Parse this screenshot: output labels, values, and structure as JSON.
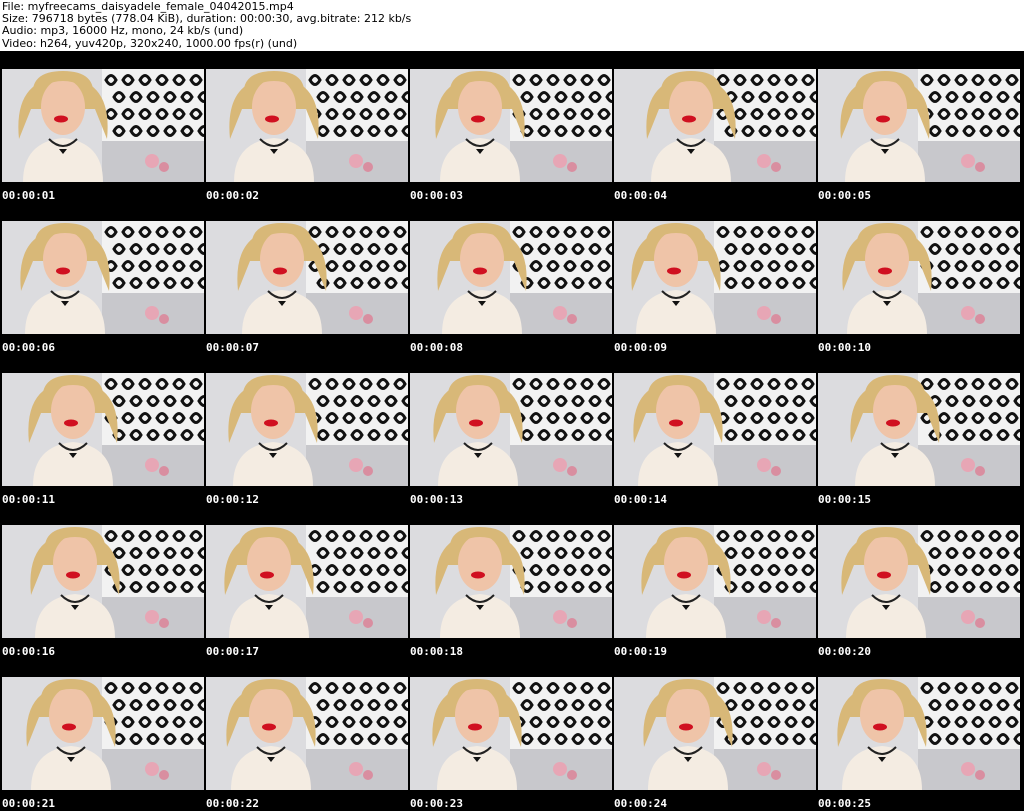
{
  "header": {
    "file_line": "File: myfreecams_daisyadele_female_04042015.mp4",
    "size_line": "Size: 796718 bytes (778.04 KiB), duration: 00:00:30, avg.bitrate: 212 kb/s",
    "audio_line": "Audio: mp3, 16000 Hz, mono, 24 kb/s (und)",
    "video_line": "Video: h264, yuv420p, 320x240, 1000.00 fps(r) (und)"
  },
  "colors": {
    "background": "#000000",
    "timestamp_text": "#ffffff",
    "header_text": "#000000",
    "lips": "#d01020",
    "hair": "#d8b878"
  },
  "thumbnails": [
    {
      "time": "00:00:01"
    },
    {
      "time": "00:00:02"
    },
    {
      "time": "00:00:03"
    },
    {
      "time": "00:00:04"
    },
    {
      "time": "00:00:05"
    },
    {
      "time": "00:00:06"
    },
    {
      "time": "00:00:07"
    },
    {
      "time": "00:00:08"
    },
    {
      "time": "00:00:09"
    },
    {
      "time": "00:00:10"
    },
    {
      "time": "00:00:11"
    },
    {
      "time": "00:00:12"
    },
    {
      "time": "00:00:13"
    },
    {
      "time": "00:00:14"
    },
    {
      "time": "00:00:15"
    },
    {
      "time": "00:00:16"
    },
    {
      "time": "00:00:17"
    },
    {
      "time": "00:00:18"
    },
    {
      "time": "00:00:19"
    },
    {
      "time": "00:00:20"
    },
    {
      "time": "00:00:21"
    },
    {
      "time": "00:00:22"
    },
    {
      "time": "00:00:23"
    },
    {
      "time": "00:00:24"
    },
    {
      "time": "00:00:25"
    }
  ]
}
